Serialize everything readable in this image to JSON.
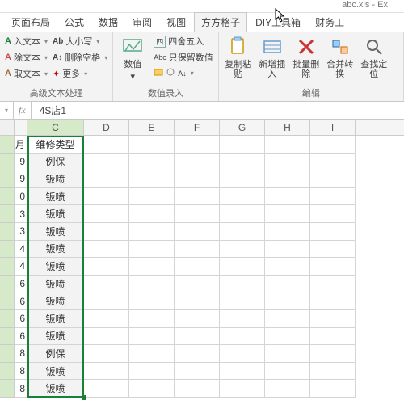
{
  "title": {
    "filename": "abc.xls - Ex"
  },
  "tabs": {
    "layout": "页面布局",
    "formulas": "公式",
    "data": "数据",
    "review": "审阅",
    "view": "视图",
    "fanggezi": "方方格子",
    "diy": "DIY工具箱",
    "caiwu": "财务工"
  },
  "ribbon": {
    "text_group_label": "高级文本处理",
    "insert_text": "入文本",
    "del_text": "除文本",
    "get_text": "取文本",
    "big_small": "大小写",
    "del_space": "删除空格",
    "more": "更多",
    "value_group_label": "数值录入",
    "shuzhi": "数值",
    "sishewuru": "四舍五入",
    "baoliu": "只保留数值",
    "fuzhi_label": "复制粘贴",
    "xinzeng_label": "新增插入",
    "piliang_label": "批量删除",
    "hebing_label": "合并转换",
    "chazhao_label": "查找定位",
    "edit_group_label": "编辑"
  },
  "formula": {
    "fx": "fx",
    "value": "4S店1"
  },
  "columns": {
    "C": "C",
    "D": "D",
    "E": "E",
    "F": "F",
    "G": "G",
    "H": "H",
    "I": "I"
  },
  "colC_header": "维修类型",
  "rows": [
    {
      "b": "9",
      "c": "例保"
    },
    {
      "b": "9",
      "c": "钣喷"
    },
    {
      "b": "0",
      "c": "钣喷"
    },
    {
      "b": "3",
      "c": "钣喷"
    },
    {
      "b": "3",
      "c": "钣喷"
    },
    {
      "b": "4",
      "c": "钣喷"
    },
    {
      "b": "4",
      "c": "钣喷"
    },
    {
      "b": "6",
      "c": "钣喷"
    },
    {
      "b": "6",
      "c": "钣喷"
    },
    {
      "b": "6",
      "c": "钣喷"
    },
    {
      "b": "6",
      "c": "钣喷"
    },
    {
      "b": "8",
      "c": "例保"
    },
    {
      "b": "8",
      "c": "钣喷"
    },
    {
      "b": "8",
      "c": "钣喷"
    }
  ]
}
